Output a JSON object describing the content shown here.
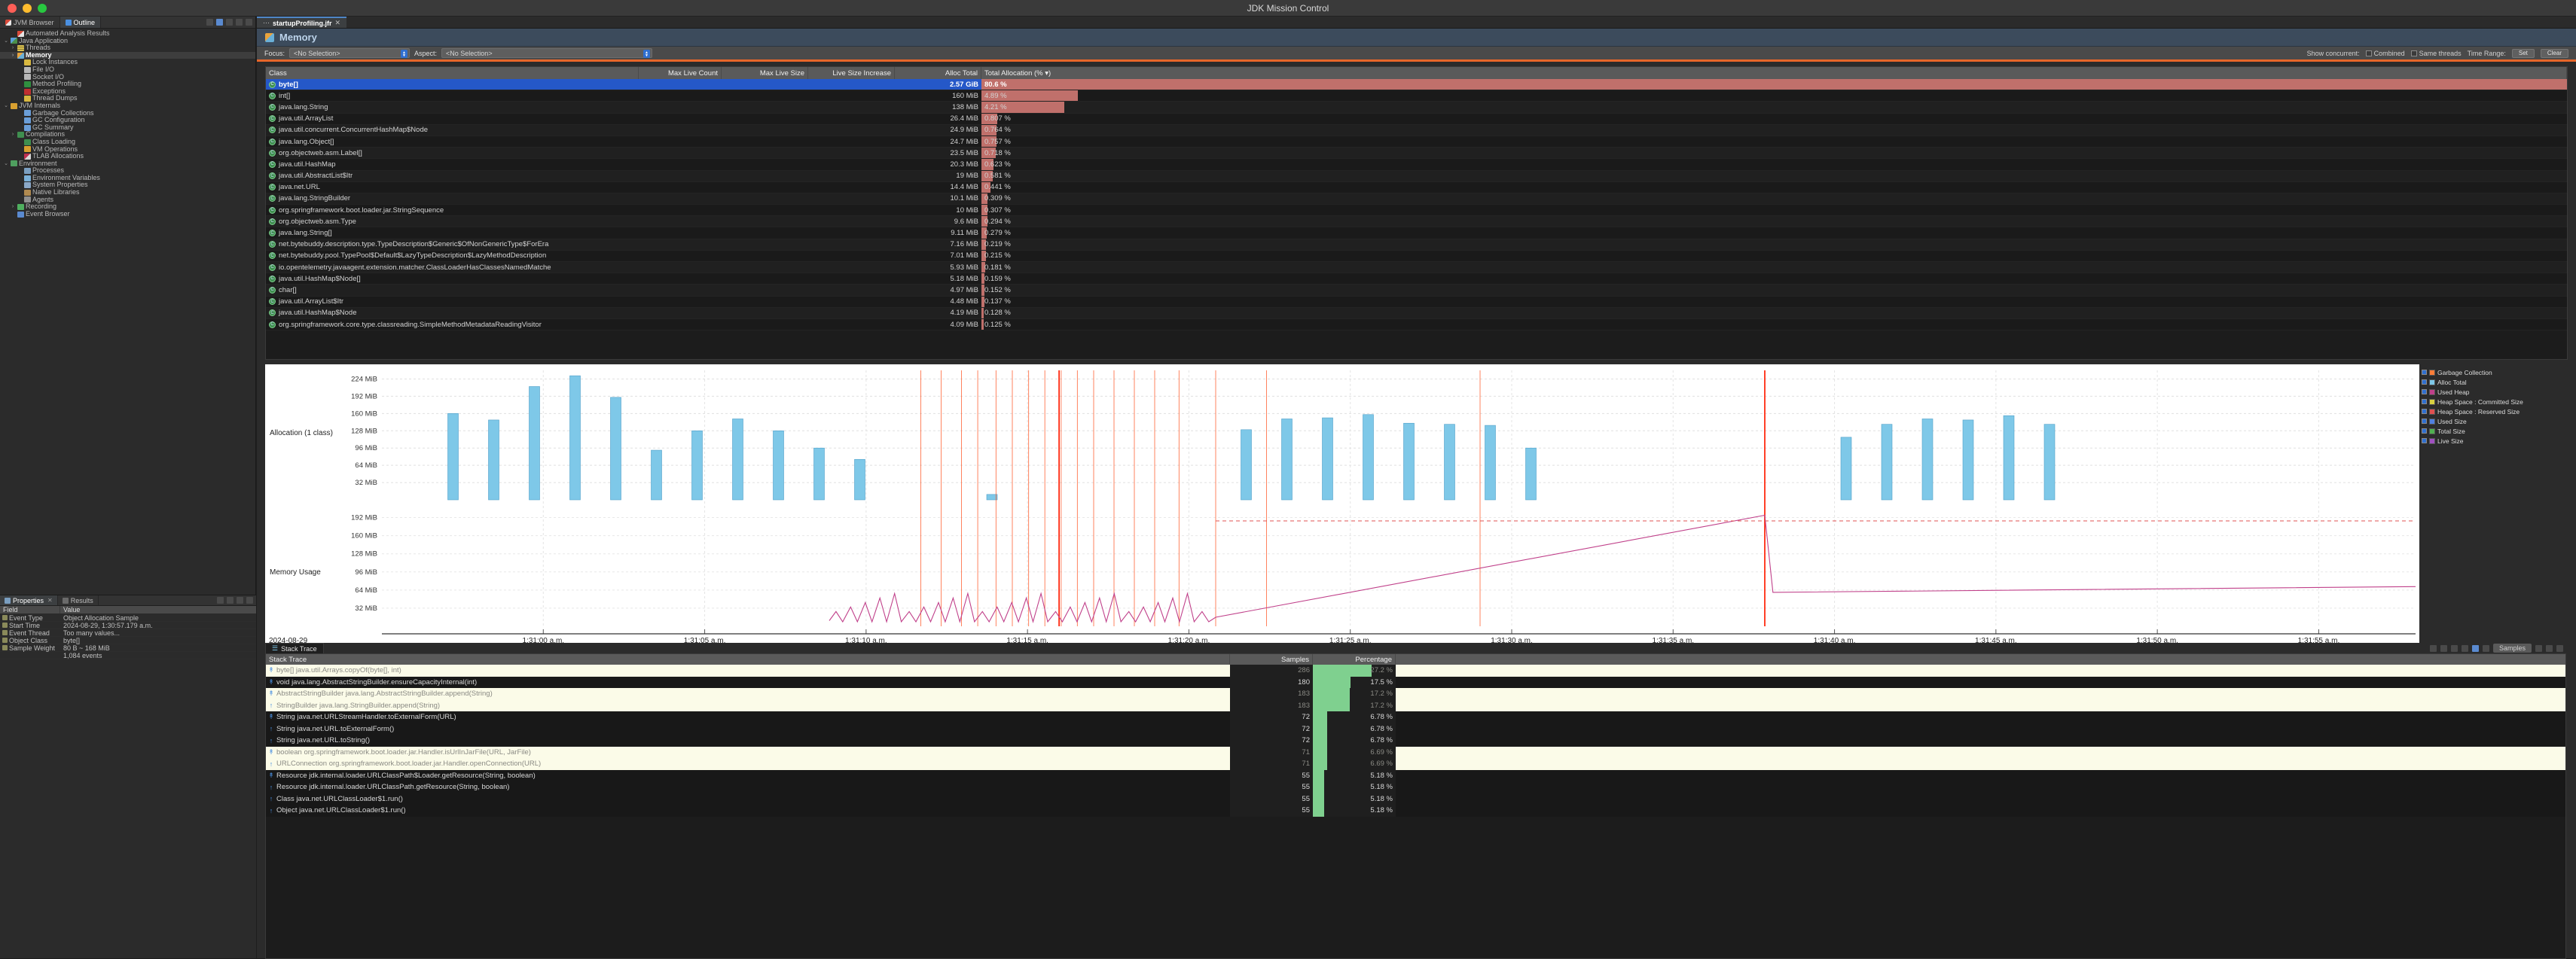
{
  "window": {
    "title": "JDK Mission Control"
  },
  "sidebar": {
    "tabs": [
      {
        "label": "JVM Browser",
        "icon": "jmc-icon",
        "active": false
      },
      {
        "label": "Outline",
        "icon": "outline-icon",
        "active": true
      }
    ],
    "tree": [
      {
        "label": "Automated Analysis Results",
        "indent": 1,
        "twist": "",
        "icon": "jmc-icon",
        "selected": false
      },
      {
        "label": "Java Application",
        "indent": 0,
        "twist": "v",
        "icon": "java-app-icon",
        "selected": false
      },
      {
        "label": "Threads",
        "indent": 1,
        "twist": ">",
        "icon": "threads-icon",
        "selected": false
      },
      {
        "label": "Memory",
        "indent": 1,
        "twist": ">",
        "icon": "memory-icon",
        "selected": true
      },
      {
        "label": "Lock Instances",
        "indent": 2,
        "twist": "",
        "icon": "lock-icon",
        "selected": false
      },
      {
        "label": "File I/O",
        "indent": 2,
        "twist": "",
        "icon": "file-io-icon",
        "selected": false
      },
      {
        "label": "Socket I/O",
        "indent": 2,
        "twist": "",
        "icon": "socket-io-icon",
        "selected": false
      },
      {
        "label": "Method Profiling",
        "indent": 2,
        "twist": "",
        "icon": "method-icon",
        "selected": false
      },
      {
        "label": "Exceptions",
        "indent": 2,
        "twist": "",
        "icon": "exception-icon",
        "selected": false
      },
      {
        "label": "Thread Dumps",
        "indent": 2,
        "twist": "",
        "icon": "thread-dump-icon",
        "selected": false
      },
      {
        "label": "JVM Internals",
        "indent": 0,
        "twist": "v",
        "icon": "jvm-internals-icon",
        "selected": false
      },
      {
        "label": "Garbage Collections",
        "indent": 2,
        "twist": "",
        "icon": "gc-icon",
        "selected": false
      },
      {
        "label": "GC Configuration",
        "indent": 2,
        "twist": "",
        "icon": "gc-config-icon",
        "selected": false
      },
      {
        "label": "GC Summary",
        "indent": 2,
        "twist": "",
        "icon": "gc-summary-icon",
        "selected": false
      },
      {
        "label": "Compilations",
        "indent": 1,
        "twist": ">",
        "icon": "compile-icon",
        "selected": false
      },
      {
        "label": "Class Loading",
        "indent": 2,
        "twist": "",
        "icon": "class-load-icon",
        "selected": false
      },
      {
        "label": "VM Operations",
        "indent": 2,
        "twist": "",
        "icon": "vm-ops-icon",
        "selected": false
      },
      {
        "label": "TLAB Allocations",
        "indent": 2,
        "twist": "",
        "icon": "tlab-icon",
        "selected": false
      },
      {
        "label": "Environment",
        "indent": 0,
        "twist": "v",
        "icon": "environment-icon",
        "selected": false
      },
      {
        "label": "Processes",
        "indent": 2,
        "twist": "",
        "icon": "process-icon",
        "selected": false
      },
      {
        "label": "Environment Variables",
        "indent": 2,
        "twist": "",
        "icon": "env-var-icon",
        "selected": false
      },
      {
        "label": "System Properties",
        "indent": 2,
        "twist": "",
        "icon": "sys-prop-icon",
        "selected": false
      },
      {
        "label": "Native Libraries",
        "indent": 2,
        "twist": "",
        "icon": "native-lib-icon",
        "selected": false
      },
      {
        "label": "Agents",
        "indent": 2,
        "twist": "",
        "icon": "agent-icon",
        "selected": false
      },
      {
        "label": "Recording",
        "indent": 1,
        "twist": ">",
        "icon": "recording-icon",
        "selected": false
      },
      {
        "label": "Event Browser",
        "indent": 1,
        "twist": "",
        "icon": "event-browser-icon",
        "selected": false
      }
    ]
  },
  "properties": {
    "tabs": [
      {
        "label": "Properties",
        "active": true,
        "closeable": true
      },
      {
        "label": "Results",
        "active": false,
        "closeable": false
      }
    ],
    "headers": [
      "Field",
      "Value"
    ],
    "rows": [
      {
        "field": "Event Type",
        "value": "Object Allocation Sample"
      },
      {
        "field": "Start Time",
        "value": "2024-08-29, 1:30:57.179 a.m."
      },
      {
        "field": "Event Thread",
        "value": "Too many values..."
      },
      {
        "field": "Object Class",
        "value": "byte[]"
      },
      {
        "field": "Sample Weight",
        "value": "80 B ~ 168 MiB"
      },
      {
        "field": "",
        "value": "1,084 events"
      }
    ]
  },
  "editor": {
    "tabs": [
      {
        "label": "startupProfiling.jfr",
        "active": true,
        "closeable": true
      }
    ]
  },
  "memory_page": {
    "title": "Memory",
    "focus_label": "Focus:",
    "focus_value": "<No Selection>",
    "aspect_label": "Aspect:",
    "aspect_value": "<No Selection>",
    "show_concurrent": "Show concurrent:",
    "toggles": [
      "Combined",
      "Same threads"
    ],
    "time_range_label": "Time Range:",
    "buttons": [
      "Set",
      "Clear"
    ]
  },
  "class_table": {
    "headers": [
      "Class",
      "Max Live Count",
      "Max Live Size",
      "Live Size Increase",
      "Alloc Total",
      "Total Allocation (% ▾)"
    ],
    "rows": [
      {
        "cls": "byte[]",
        "max_live_count": "",
        "max_live_size": "",
        "live_size_increase": "",
        "alloc_total": "2.57 GiB",
        "pct": "80.6 %",
        "pct_val": 80.6,
        "selected": true
      },
      {
        "cls": "int[]",
        "max_live_count": "",
        "max_live_size": "",
        "live_size_increase": "",
        "alloc_total": "160 MiB",
        "pct": "4.89 %",
        "pct_val": 4.89,
        "selected": false
      },
      {
        "cls": "java.lang.String",
        "max_live_count": "",
        "max_live_size": "",
        "live_size_increase": "",
        "alloc_total": "138 MiB",
        "pct": "4.21 %",
        "pct_val": 4.21,
        "selected": false
      },
      {
        "cls": "java.util.ArrayList",
        "max_live_count": "",
        "max_live_size": "",
        "live_size_increase": "",
        "alloc_total": "26.4 MiB",
        "pct": "0.807 %",
        "pct_val": 0.807,
        "selected": false
      },
      {
        "cls": "java.util.concurrent.ConcurrentHashMap$Node",
        "max_live_count": "",
        "max_live_size": "",
        "live_size_increase": "",
        "alloc_total": "24.9 MiB",
        "pct": "0.764 %",
        "pct_val": 0.764,
        "selected": false
      },
      {
        "cls": "java.lang.Object[]",
        "max_live_count": "",
        "max_live_size": "",
        "live_size_increase": "",
        "alloc_total": "24.7 MiB",
        "pct": "0.757 %",
        "pct_val": 0.757,
        "selected": false
      },
      {
        "cls": "org.objectweb.asm.Label[]",
        "max_live_count": "",
        "max_live_size": "",
        "live_size_increase": "",
        "alloc_total": "23.5 MiB",
        "pct": "0.718 %",
        "pct_val": 0.718,
        "selected": false
      },
      {
        "cls": "java.util.HashMap",
        "max_live_count": "",
        "max_live_size": "",
        "live_size_increase": "",
        "alloc_total": "20.3 MiB",
        "pct": "0.623 %",
        "pct_val": 0.623,
        "selected": false
      },
      {
        "cls": "java.util.AbstractList$Itr",
        "max_live_count": "",
        "max_live_size": "",
        "live_size_increase": "",
        "alloc_total": "19 MiB",
        "pct": "0.581 %",
        "pct_val": 0.581,
        "selected": false
      },
      {
        "cls": "java.net.URL",
        "max_live_count": "",
        "max_live_size": "",
        "live_size_increase": "",
        "alloc_total": "14.4 MiB",
        "pct": "0.441 %",
        "pct_val": 0.441,
        "selected": false
      },
      {
        "cls": "java.lang.StringBuilder",
        "max_live_count": "",
        "max_live_size": "",
        "live_size_increase": "",
        "alloc_total": "10.1 MiB",
        "pct": "0.309 %",
        "pct_val": 0.309,
        "selected": false
      },
      {
        "cls": "org.springframework.boot.loader.jar.StringSequence",
        "max_live_count": "",
        "max_live_size": "",
        "live_size_increase": "",
        "alloc_total": "10 MiB",
        "pct": "0.307 %",
        "pct_val": 0.307,
        "selected": false
      },
      {
        "cls": "org.objectweb.asm.Type",
        "max_live_count": "",
        "max_live_size": "",
        "live_size_increase": "",
        "alloc_total": "9.6 MiB",
        "pct": "0.294 %",
        "pct_val": 0.294,
        "selected": false
      },
      {
        "cls": "java.lang.String[]",
        "max_live_count": "",
        "max_live_size": "",
        "live_size_increase": "",
        "alloc_total": "9.11 MiB",
        "pct": "0.279 %",
        "pct_val": 0.279,
        "selected": false
      },
      {
        "cls": "net.bytebuddy.description.type.TypeDescription$Generic$OfNonGenericType$ForEra",
        "max_live_count": "",
        "max_live_size": "",
        "live_size_increase": "",
        "alloc_total": "7.16 MiB",
        "pct": "0.219 %",
        "pct_val": 0.219,
        "selected": false
      },
      {
        "cls": "net.bytebuddy.pool.TypePool$Default$LazyTypeDescription$LazyMethodDescription",
        "max_live_count": "",
        "max_live_size": "",
        "live_size_increase": "",
        "alloc_total": "7.01 MiB",
        "pct": "0.215 %",
        "pct_val": 0.215,
        "selected": false
      },
      {
        "cls": "io.opentelemetry.javaagent.extension.matcher.ClassLoaderHasClassesNamedMatche",
        "max_live_count": "",
        "max_live_size": "",
        "live_size_increase": "",
        "alloc_total": "5.93 MiB",
        "pct": "0.181 %",
        "pct_val": 0.181,
        "selected": false
      },
      {
        "cls": "java.util.HashMap$Node[]",
        "max_live_count": "",
        "max_live_size": "",
        "live_size_increase": "",
        "alloc_total": "5.18 MiB",
        "pct": "0.159 %",
        "pct_val": 0.159,
        "selected": false
      },
      {
        "cls": "char[]",
        "max_live_count": "",
        "max_live_size": "",
        "live_size_increase": "",
        "alloc_total": "4.97 MiB",
        "pct": "0.152 %",
        "pct_val": 0.152,
        "selected": false
      },
      {
        "cls": "java.util.ArrayList$Itr",
        "max_live_count": "",
        "max_live_size": "",
        "live_size_increase": "",
        "alloc_total": "4.48 MiB",
        "pct": "0.137 %",
        "pct_val": 0.137,
        "selected": false
      },
      {
        "cls": "java.util.HashMap$Node",
        "max_live_count": "",
        "max_live_size": "",
        "live_size_increase": "",
        "alloc_total": "4.19 MiB",
        "pct": "0.128 %",
        "pct_val": 0.128,
        "selected": false
      },
      {
        "cls": "org.springframework.core.type.classreading.SimpleMethodMetadataReadingVisitor",
        "max_live_count": "",
        "max_live_size": "",
        "live_size_increase": "",
        "alloc_total": "4.09 MiB",
        "pct": "0.125 %",
        "pct_val": 0.125,
        "selected": false
      }
    ]
  },
  "chart_data": [
    {
      "type": "bar",
      "title": "Allocation (1 class)",
      "ylabel": "Allocation (1 class)",
      "xlabel": "",
      "ytick_labels": [
        "32 MiB",
        "64 MiB",
        "96 MiB",
        "128 MiB",
        "160 MiB",
        "192 MiB",
        "224 MiB"
      ],
      "ytick_values": [
        32,
        64,
        96,
        128,
        160,
        192,
        224
      ],
      "ylim": [
        0,
        240
      ],
      "xlim": [
        "1:30:55 a.m.",
        "1:31:57 a.m."
      ],
      "bar_color": "#7ec8e8",
      "grid": true,
      "x": [
        3.5,
        5.5,
        7.5,
        9.5,
        11.5,
        13.5,
        15.5,
        17.5,
        19.5,
        21.5,
        23.5,
        30.0,
        42.5,
        44.5,
        46.5,
        48.5,
        50.5,
        52.5,
        54.5,
        56.5,
        72.0,
        74.0,
        76.0,
        78.0,
        80.0,
        82.0
      ],
      "values": [
        160,
        148,
        210,
        230,
        190,
        92,
        128,
        150,
        128,
        96,
        75,
        10,
        130,
        150,
        152,
        158,
        142,
        140,
        138,
        96,
        116,
        140,
        150,
        148,
        156,
        140
      ]
    },
    {
      "type": "line",
      "title": "Memory Usage",
      "ylabel": "Memory Usage",
      "ytick_labels": [
        "32 MiB",
        "64 MiB",
        "96 MiB",
        "128 MiB",
        "160 MiB",
        "192 MiB"
      ],
      "ytick_values": [
        32,
        64,
        96,
        128,
        160,
        192
      ],
      "ylim": [
        0,
        210
      ],
      "line_color": "#c0408a",
      "grid": true,
      "series": [
        {
          "name": "Used Heap",
          "color": "#c0408a"
        }
      ]
    }
  ],
  "time_axis": {
    "date": "2024-08-29",
    "ticks": [
      "1:31:00 a.m.",
      "1:31:05 a.m.",
      "1:31:10 a.m.",
      "1:31:15 a.m.",
      "1:31:20 a.m.",
      "1:31:25 a.m.",
      "1:31:30 a.m.",
      "1:31:35 a.m.",
      "1:31:40 a.m.",
      "1:31:45 a.m.",
      "1:31:50 a.m.",
      "1:31:55 a.m."
    ]
  },
  "chart_legend": [
    {
      "label": "Garbage Collection",
      "checked": true,
      "color": "#ff7d38"
    },
    {
      "label": "Alloc Total",
      "checked": true,
      "color": "#7ec8e8"
    },
    {
      "label": "Used Heap",
      "checked": true,
      "color": "#c0408a"
    },
    {
      "label": "Heap Space : Committed Size",
      "checked": true,
      "color": "#d8d040"
    },
    {
      "label": "Heap Space : Reserved Size",
      "checked": true,
      "color": "#e05050"
    },
    {
      "label": "Used Size",
      "checked": true,
      "color": "#5080e0"
    },
    {
      "label": "Total Size",
      "checked": true,
      "color": "#50b050"
    },
    {
      "label": "Live Size",
      "checked": true,
      "color": "#a050c0"
    }
  ],
  "stack_trace": {
    "tab_label": "Stack Trace",
    "headers": [
      "Stack Trace",
      "Samples",
      "Percentage"
    ],
    "samples_label": "Samples",
    "rows": [
      {
        "frame": "byte[] java.util.Arrays.copyOf(byte[], int)",
        "samples": "286",
        "pct": "27.2 %",
        "pct_val": 27.2,
        "style": "hl",
        "arrow": "branch"
      },
      {
        "frame": "void java.lang.AbstractStringBuilder.ensureCapacityInternal(int)",
        "samples": "180",
        "pct": "17.5 %",
        "pct_val": 17.5,
        "style": "dk",
        "arrow": "branch"
      },
      {
        "frame": "AbstractStringBuilder java.lang.AbstractStringBuilder.append(String)",
        "samples": "183",
        "pct": "17.2 %",
        "pct_val": 17.2,
        "style": "hl",
        "arrow": "branch"
      },
      {
        "frame": "StringBuilder java.lang.StringBuilder.append(String)",
        "samples": "183",
        "pct": "17.2 %",
        "pct_val": 17.2,
        "style": "hl",
        "arrow": "up"
      },
      {
        "frame": "String java.net.URLStreamHandler.toExternalForm(URL)",
        "samples": "72",
        "pct": "6.78 %",
        "pct_val": 6.78,
        "style": "dk",
        "arrow": "branch"
      },
      {
        "frame": "String java.net.URL.toExternalForm()",
        "samples": "72",
        "pct": "6.78 %",
        "pct_val": 6.78,
        "style": "dk",
        "arrow": "up"
      },
      {
        "frame": "String java.net.URL.toString()",
        "samples": "72",
        "pct": "6.78 %",
        "pct_val": 6.78,
        "style": "dk",
        "arrow": "up"
      },
      {
        "frame": "boolean org.springframework.boot.loader.jar.Handler.isUrlInJarFile(URL, JarFile)",
        "samples": "71",
        "pct": "6.69 %",
        "pct_val": 6.69,
        "style": "hl",
        "arrow": "branch"
      },
      {
        "frame": "URLConnection org.springframework.boot.loader.jar.Handler.openConnection(URL)",
        "samples": "71",
        "pct": "6.69 %",
        "pct_val": 6.69,
        "style": "hl",
        "arrow": "up"
      },
      {
        "frame": "Resource jdk.internal.loader.URLClassPath$Loader.getResource(String, boolean)",
        "samples": "55",
        "pct": "5.18 %",
        "pct_val": 5.18,
        "style": "dk",
        "arrow": "branch"
      },
      {
        "frame": "Resource jdk.internal.loader.URLClassPath.getResource(String, boolean)",
        "samples": "55",
        "pct": "5.18 %",
        "pct_val": 5.18,
        "style": "dk",
        "arrow": "up"
      },
      {
        "frame": "Class java.net.URLClassLoader$1.run()",
        "samples": "55",
        "pct": "5.18 %",
        "pct_val": 5.18,
        "style": "dk",
        "arrow": "up"
      },
      {
        "frame": "Object java.net.URLClassLoader$1.run()",
        "samples": "55",
        "pct": "5.18 %",
        "pct_val": 5.18,
        "style": "dk",
        "arrow": "up"
      }
    ]
  }
}
